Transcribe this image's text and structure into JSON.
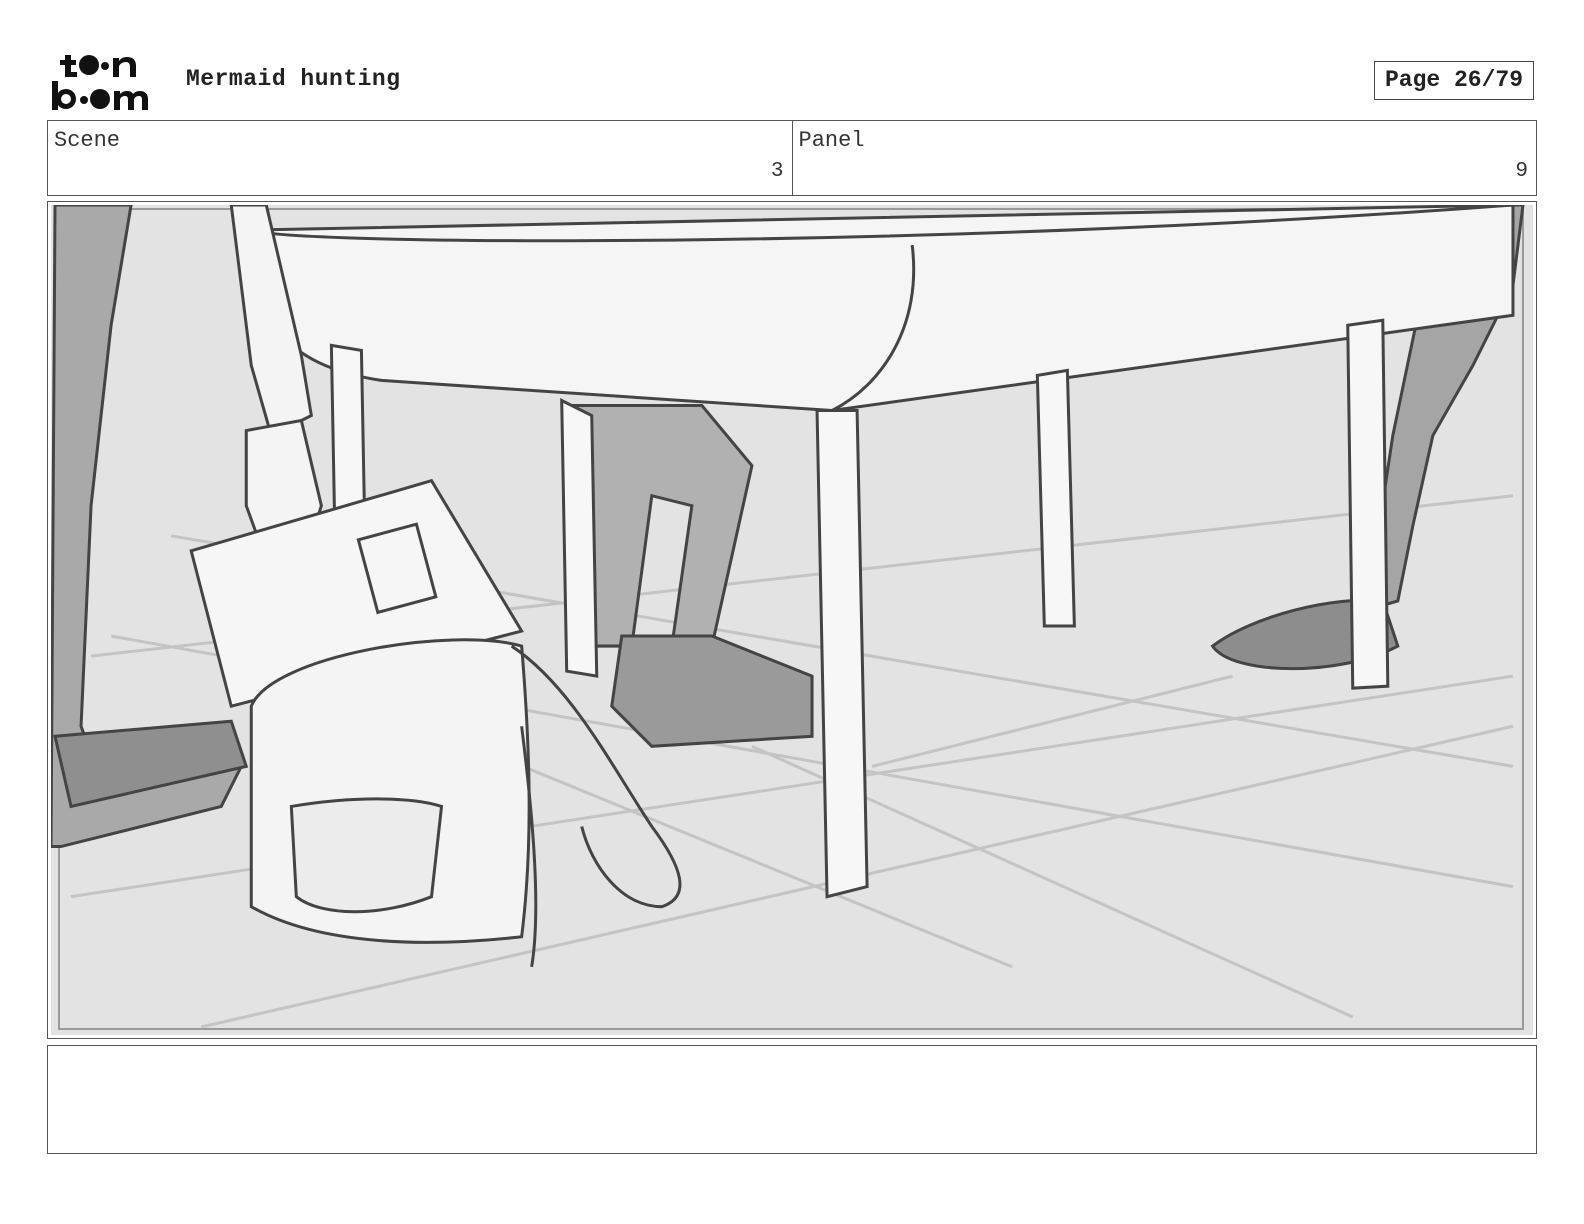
{
  "header": {
    "logo_text": "toon boom",
    "project_title": "Mermaid hunting",
    "page_label": "Page 26/79"
  },
  "info": {
    "scene_label": "Scene",
    "scene_value": "3",
    "panel_label": "Panel",
    "panel_value": "9"
  },
  "notes": {
    "text": ""
  }
}
